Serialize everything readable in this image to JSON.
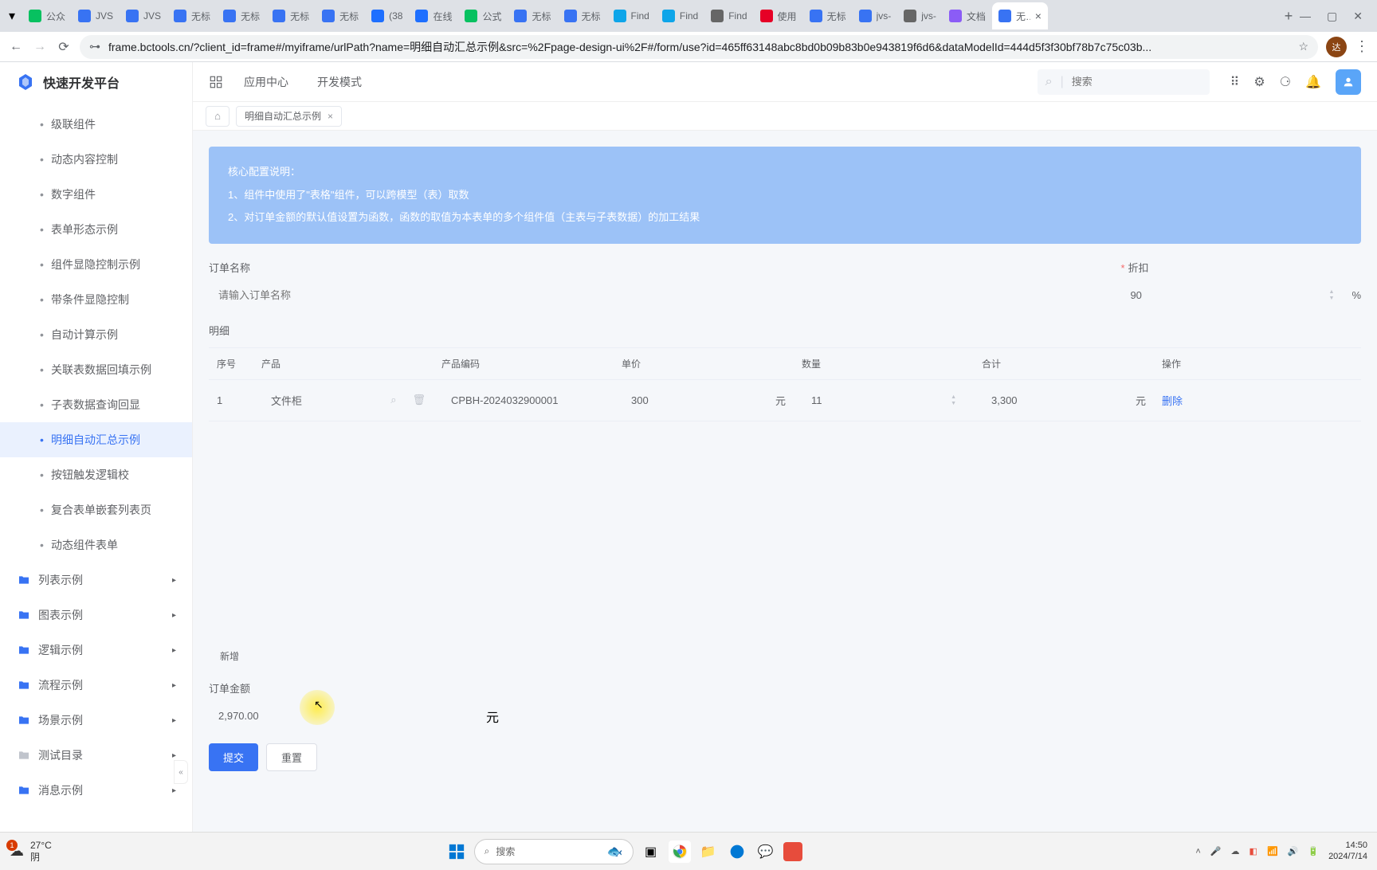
{
  "browser": {
    "tabs": [
      {
        "label": "公众",
        "color": "#07c160"
      },
      {
        "label": "JVS",
        "color": "#3873f3"
      },
      {
        "label": "JVS",
        "color": "#3873f3"
      },
      {
        "label": "无标",
        "color": "#3873f3"
      },
      {
        "label": "无标",
        "color": "#3873f3"
      },
      {
        "label": "无标",
        "color": "#3873f3"
      },
      {
        "label": "无标",
        "color": "#3873f3"
      },
      {
        "label": "(38",
        "color": "#1e6fff"
      },
      {
        "label": "在线",
        "color": "#1e6fff"
      },
      {
        "label": "公式",
        "color": "#07c160"
      },
      {
        "label": "无标",
        "color": "#3873f3"
      },
      {
        "label": "无标",
        "color": "#3873f3"
      },
      {
        "label": "Find",
        "color": "#0ea5e9"
      },
      {
        "label": "Find",
        "color": "#0ea5e9"
      },
      {
        "label": "Find",
        "color": "#666"
      },
      {
        "label": "使用",
        "color": "#e60026"
      },
      {
        "label": "无标",
        "color": "#3873f3"
      },
      {
        "label": "jvs-",
        "color": "#3873f3"
      },
      {
        "label": "jvs-",
        "color": "#666"
      },
      {
        "label": "文档",
        "color": "#8b5cf6"
      },
      {
        "label": "无标",
        "color": "#3873f3",
        "active": true
      }
    ],
    "url": "frame.bctools.cn/?client_id=frame#/myiframe/urlPath?name=明细自动汇总示例&src=%2Fpage-design-ui%2F#/form/use?id=465ff63148abc8bd0b09b83b0e943819f6d6&dataModelId=444d5f3f30bf78b7c75c03b..."
  },
  "app": {
    "logo_text": "快速开发平台",
    "nav": {
      "app_center": "应用中心",
      "dev_mode": "开发模式"
    },
    "search_placeholder": "搜索"
  },
  "sidebar": {
    "leaf_items": [
      "级联组件",
      "动态内容控制",
      "数字组件",
      "表单形态示例",
      "组件显隐控制示例",
      "带条件显隐控制",
      "自动计算示例",
      "关联表数据回填示例",
      "子表数据查询回显",
      "明细自动汇总示例",
      "按钮触发逻辑校",
      "复合表单嵌套列表页",
      "动态组件表单"
    ],
    "active_index": 9,
    "folders": [
      "列表示例",
      "图表示例",
      "逻辑示例",
      "流程示例",
      "场景示例",
      "测试目录",
      "消息示例"
    ]
  },
  "tabs": {
    "page_tab": "明细自动汇总示例"
  },
  "info": {
    "title": "核心配置说明：",
    "line1": "1、组件中使用了\"表格\"组件，可以跨模型（表）取数",
    "line2": "2、对订单金额的默认值设置为函数，函数的取值为本表单的多个组件值（主表与子表数据）的加工结果"
  },
  "form": {
    "order_name_label": "订单名称",
    "order_name_placeholder": "请输入订单名称",
    "discount_label": "折扣",
    "discount_value": "90",
    "discount_unit": "%",
    "detail_label": "明细",
    "add_btn": "新增",
    "amount_label": "订单金额",
    "amount_value": "2,970.00",
    "amount_unit": "元",
    "submit": "提交",
    "reset": "重置"
  },
  "table": {
    "headers": {
      "idx": "序号",
      "product": "产品",
      "code": "产品编码",
      "price": "单价",
      "qty": "数量",
      "total": "合计",
      "action": "操作"
    },
    "rows": [
      {
        "idx": "1",
        "product": "文件柜",
        "code": "CPBH-2024032900001",
        "price": "300",
        "price_unit": "元",
        "qty": "11",
        "total": "3,300",
        "total_unit": "元",
        "action": "删除"
      }
    ]
  },
  "taskbar": {
    "weather_temp": "27°C",
    "weather_cond": "阴",
    "weather_badge": "1",
    "search": "搜索",
    "time": "14:50",
    "date": "2024/7/14"
  }
}
